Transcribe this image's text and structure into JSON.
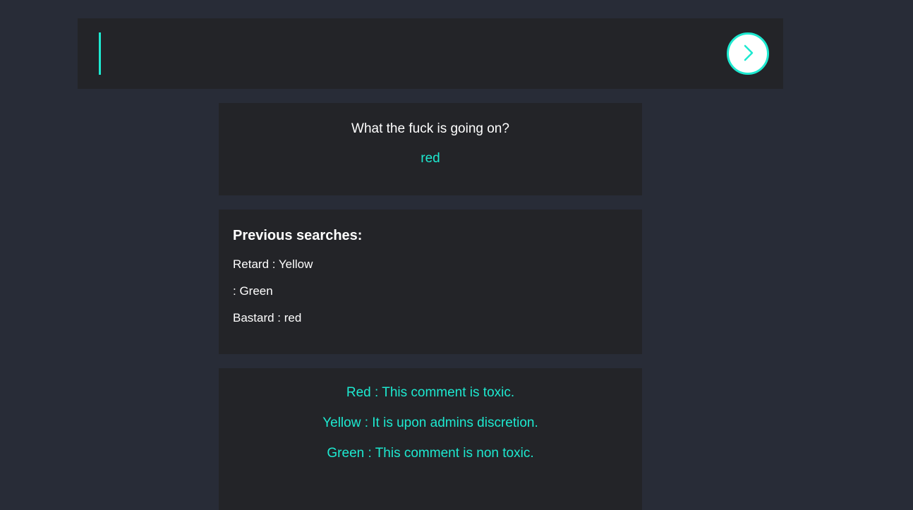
{
  "search": {
    "value": "",
    "placeholder": ""
  },
  "submit": {
    "icon": "chevron-right-icon"
  },
  "result": {
    "query": "What the fuck is going on?",
    "label": "red"
  },
  "history": {
    "title": "Previous searches:",
    "items": [
      "Retard : Yellow",
      ": Green",
      "Bastard : red"
    ]
  },
  "legend": {
    "items": [
      "Red : This comment is toxic.",
      "Yellow : It is upon admins discretion.",
      "Green : This comment is non toxic."
    ]
  },
  "colors": {
    "background": "#282c37",
    "panel": "#232428",
    "accent": "#1de9d0",
    "text": "#ffffff"
  }
}
